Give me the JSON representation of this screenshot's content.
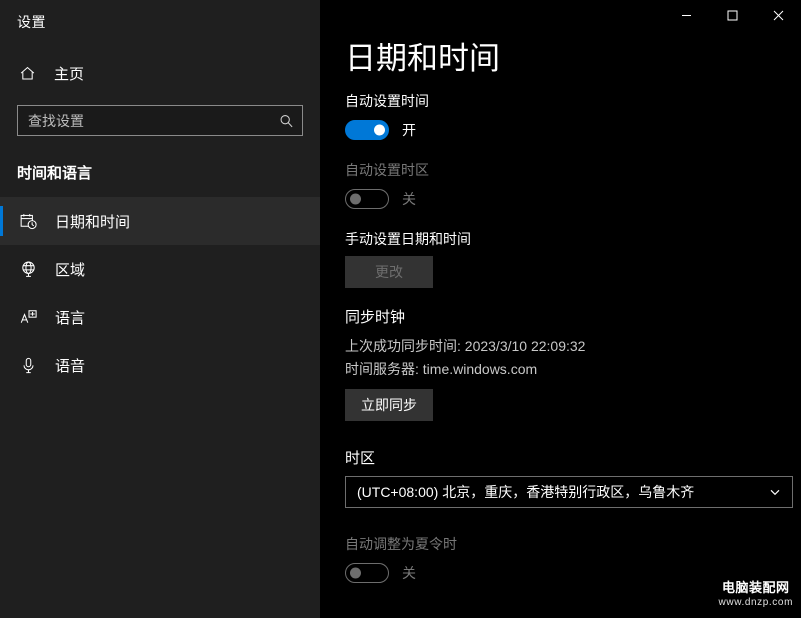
{
  "window": {
    "app_title": "设置",
    "controls": [
      {
        "name": "minimize",
        "glyph": "—"
      },
      {
        "name": "maximize",
        "glyph": "□"
      },
      {
        "name": "close",
        "glyph": "×"
      }
    ]
  },
  "sidebar": {
    "home_label": "主页",
    "home_icon": "home-icon",
    "search": {
      "placeholder": "查找设置",
      "value": "",
      "icon": "search-icon"
    },
    "category_title": "时间和语言",
    "items": [
      {
        "label": "日期和时间",
        "icon": "calendar-clock-icon",
        "selected": true
      },
      {
        "label": "区域",
        "icon": "globe-icon",
        "selected": false
      },
      {
        "label": "语言",
        "icon": "language-icon",
        "selected": false
      },
      {
        "label": "语音",
        "icon": "microphone-icon",
        "selected": false
      }
    ]
  },
  "main": {
    "page_title": "日期和时间",
    "auto_time": {
      "label": "自动设置时间",
      "state_text": "开",
      "on": true,
      "disabled": false
    },
    "auto_timezone": {
      "label": "自动设置时区",
      "state_text": "关",
      "on": false,
      "disabled": true
    },
    "manual_datetime": {
      "label": "手动设置日期和时间",
      "button_label": "更改",
      "button_disabled": true
    },
    "sync_clock": {
      "title": "同步时钟",
      "last_sync_line": "上次成功同步时间: 2023/3/10 22:09:32",
      "server_line": "时间服务器: time.windows.com",
      "button_label": "立即同步"
    },
    "timezone": {
      "title": "时区",
      "selected": "(UTC+08:00) 北京，重庆，香港特别行政区，乌鲁木齐",
      "chevron_icon": "chevron-down-icon"
    },
    "dst": {
      "label": "自动调整为夏令时",
      "state_text": "关",
      "on": false,
      "disabled": true
    }
  },
  "watermark": {
    "title": "电脑装配网",
    "url": "www.dnzp.com"
  },
  "colors": {
    "accent": "#0078d7",
    "sidebar_bg": "#1f1f1f",
    "main_bg": "#000000",
    "button_bg": "#333333"
  }
}
